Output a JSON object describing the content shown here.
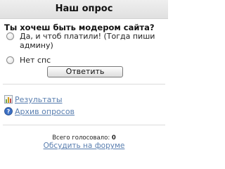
{
  "poll": {
    "title": "Наш опрос",
    "question": "Ты хочеш быть модером сайта?",
    "options": [
      {
        "label": "Да, и чтоб платили! (Тогда пиши админу)",
        "selected": false
      },
      {
        "label": "Нет спс",
        "selected": false
      }
    ],
    "vote_button": "Ответить"
  },
  "links": {
    "results": {
      "label": "Результаты",
      "icon": "bar-chart-icon"
    },
    "archive": {
      "label": "Архив опросов",
      "icon": "help-icon"
    }
  },
  "stats": {
    "total_label": "Всего голосовало:",
    "total_value": "0"
  },
  "discuss_label": "Обсудить на форуме",
  "colors": {
    "link": "#5a7fb0",
    "header_bg": "#e8e8e8",
    "divider": "#dcdcdc"
  }
}
